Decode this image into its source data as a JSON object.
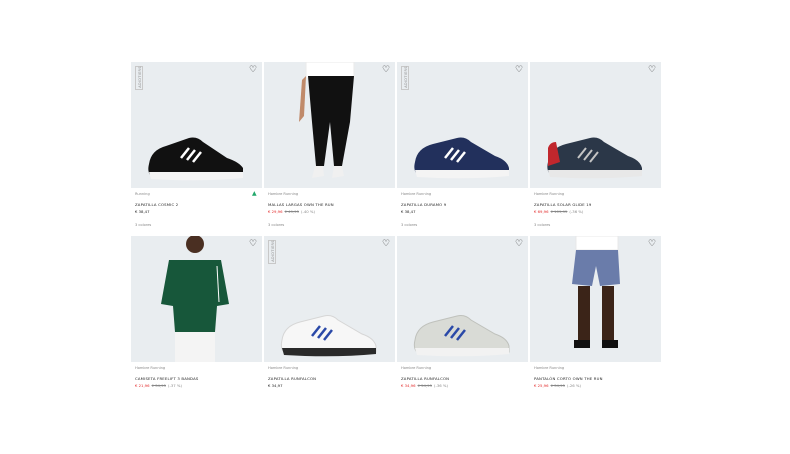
{
  "products": [
    {
      "category": "Running",
      "name": "ZAPATILLA COSMIC 2",
      "price": "€ 38,47",
      "sale_price": "",
      "orig_price": "",
      "discount": "",
      "colors": "3 colores",
      "badge": "ADIDTIERS"
    },
    {
      "category": "Hombre Running",
      "name": "MALLAS LARGAS OWN THE RUN",
      "price": "",
      "sale_price": "€ 29,96",
      "orig_price": "€ 49,95",
      "discount": "(-40 %)",
      "colors": "3 colores",
      "badge": ""
    },
    {
      "category": "Hombre Running",
      "name": "ZAPATILLA DURAMO 9",
      "price": "€ 38,47",
      "sale_price": "",
      "orig_price": "",
      "discount": "",
      "colors": "3 colores",
      "badge": "ADIDTIERS"
    },
    {
      "category": "Hombre Running",
      "name": "ZAPATILLA SOLAR GLIDE 19",
      "price": "",
      "sale_price": "€ 69,96",
      "orig_price": "€ 109,95",
      "discount": "(-36 %)",
      "colors": "3 colores",
      "badge": ""
    },
    {
      "category": "Hombre Running",
      "name": "CAMISETA FREELIFT 3 BANDAS",
      "price": "",
      "sale_price": "€ 21,96",
      "orig_price": "€ 34,95",
      "discount": "(-37 %)",
      "colors": "",
      "badge": ""
    },
    {
      "category": "Hombre Running",
      "name": "ZAPATILLA RUNFALCON",
      "price": "€ 34,97",
      "sale_price": "",
      "orig_price": "",
      "discount": "",
      "colors": "",
      "badge": "ADIDTIERS"
    },
    {
      "category": "Hombre Running",
      "name": "ZAPATILLA RUNFALCON",
      "price": "",
      "sale_price": "€ 34,96",
      "orig_price": "€ 54,95",
      "discount": "(-36 %)",
      "colors": "",
      "badge": ""
    },
    {
      "category": "Hombre Running",
      "name": "PANTALÓN CORTO OWN THE RUN",
      "price": "",
      "sale_price": "€ 25,96",
      "orig_price": "€ 34,95",
      "discount": "(-26 %)",
      "colors": "",
      "badge": ""
    }
  ],
  "icons": {
    "wishlist": "heart-icon",
    "brand": "adidas-logo-icon"
  },
  "colors": {
    "sale": "#e32b2b",
    "image_bg": "#e9edf0"
  }
}
